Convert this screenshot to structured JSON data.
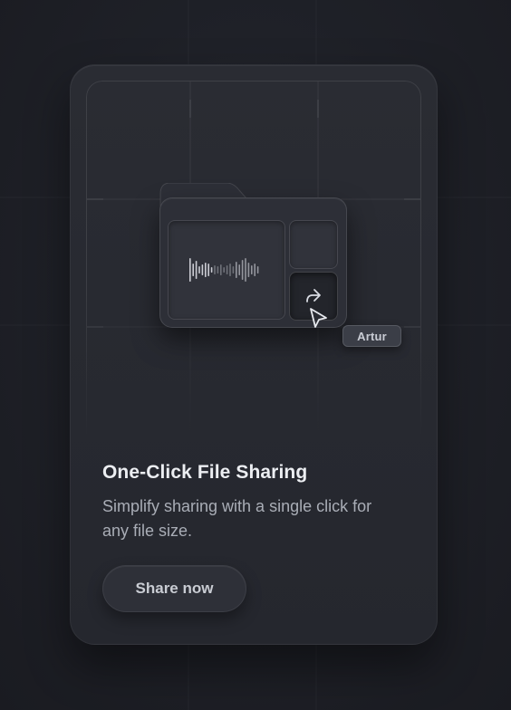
{
  "card": {
    "title": "One-Click File Sharing",
    "description": "Simplify sharing with a single click for any file size.",
    "button_label": "Share now"
  },
  "illustration": {
    "cursor_tag": "Artur",
    "share_icon": "share-arrow-icon",
    "folder_icon": "folder-icon",
    "waveform_icon": "audio-waveform-icon"
  },
  "colors": {
    "background": "#1f2128",
    "card": "#282a31",
    "title": "#eceef2",
    "description": "#a9adb6",
    "button_text": "#c9ccd3"
  }
}
